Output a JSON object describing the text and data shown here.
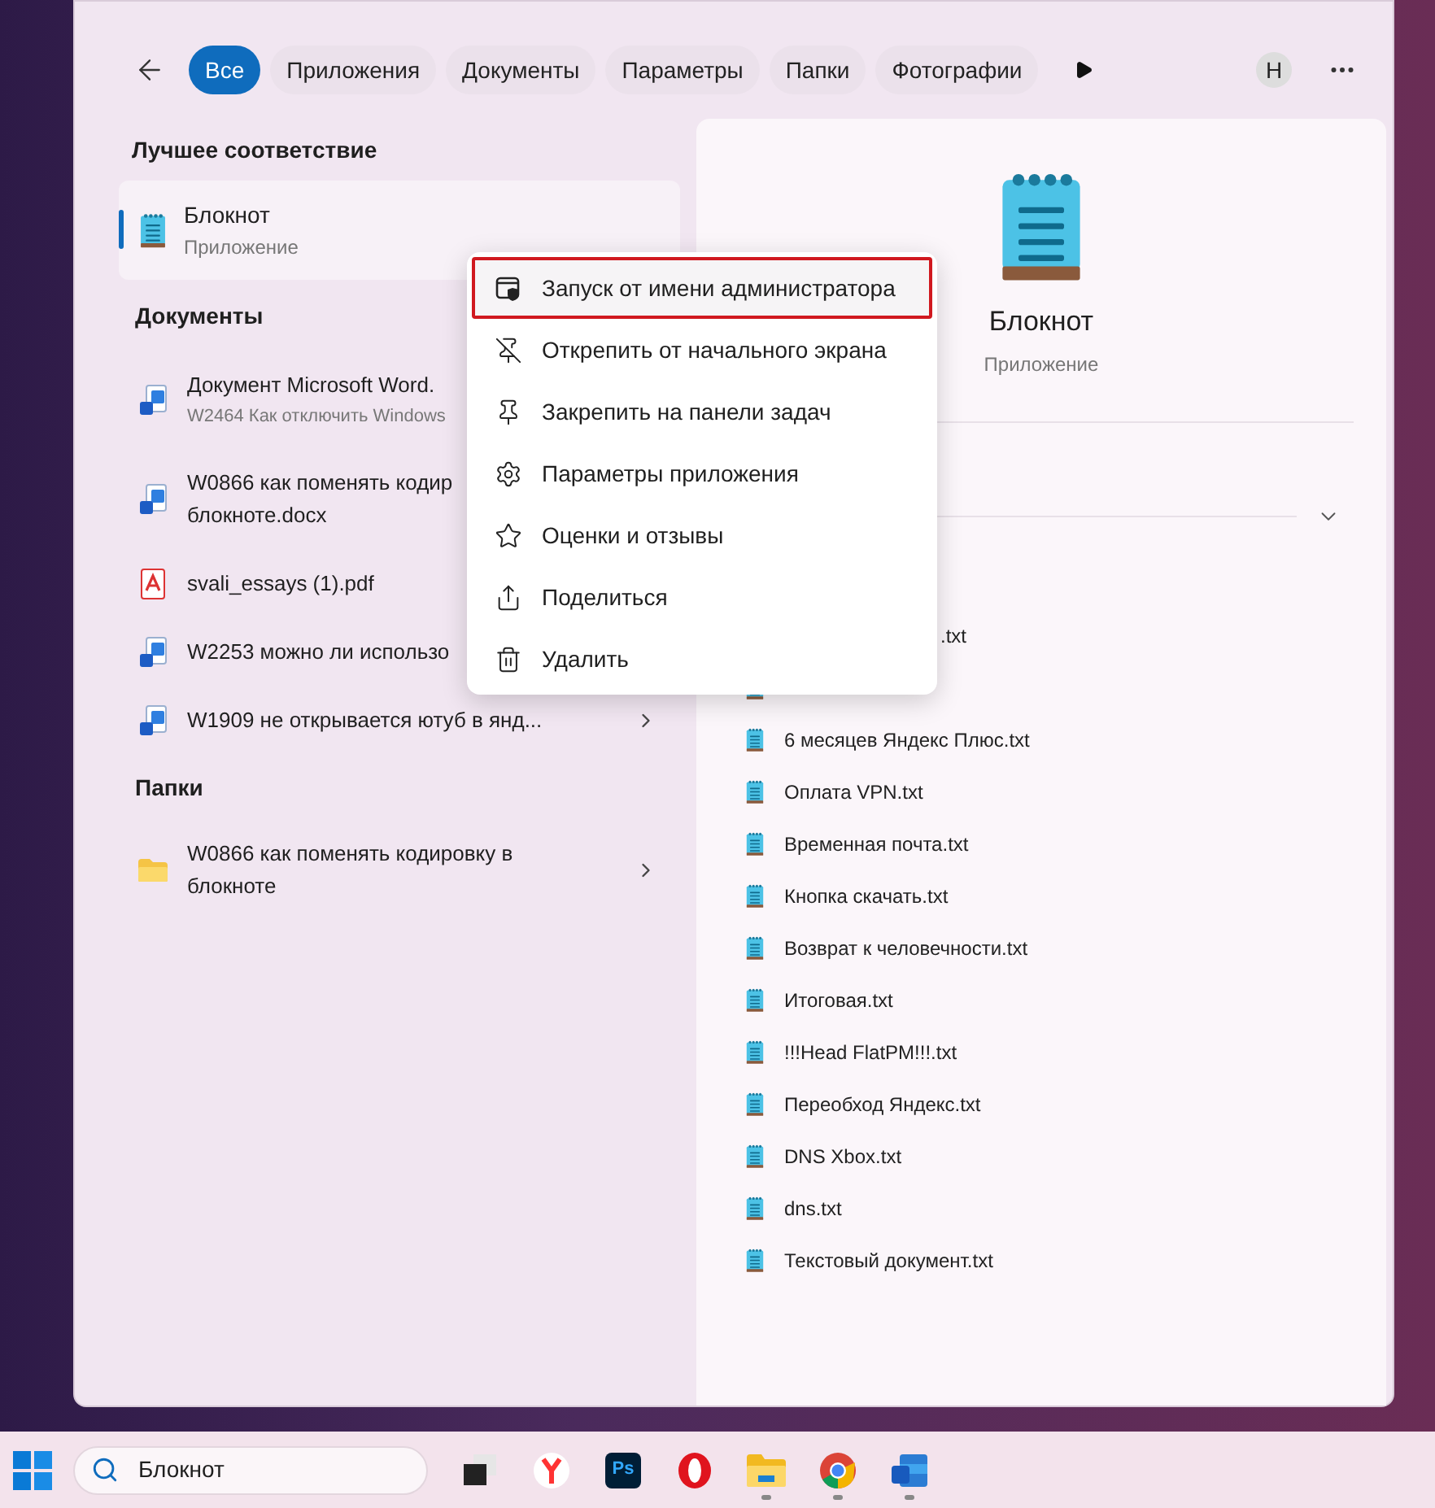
{
  "filters": [
    {
      "label": "Все",
      "selected": true
    },
    {
      "label": "Приложения",
      "selected": false
    },
    {
      "label": "Документы",
      "selected": false
    },
    {
      "label": "Параметры",
      "selected": false
    },
    {
      "label": "Папки",
      "selected": false
    },
    {
      "label": "Фотографии",
      "selected": false
    }
  ],
  "avatar": "Н",
  "best_match": {
    "heading": "Лучшее соответствие",
    "name": "Блокнот",
    "subtitle": "Приложение",
    "selected": true
  },
  "documents": {
    "heading": "Документы",
    "items": [
      {
        "kind": "word",
        "lines": [
          "Документ Microsoft Word."
        ],
        "subtitle": "W2464 Как отключить Windows"
      },
      {
        "kind": "word",
        "lines": [
          "W0866 как поменять кодир",
          "блокноте.docx"
        ]
      },
      {
        "kind": "pdf",
        "lines": [
          "svali_essays (1).pdf"
        ]
      },
      {
        "kind": "word",
        "lines": [
          "W2253 можно ли использо"
        ]
      },
      {
        "kind": "word",
        "lines": [
          "W1909 не открывается ютуб в янд..."
        ],
        "arrow": true
      }
    ]
  },
  "folders": {
    "heading": "Папки",
    "items": [
      {
        "kind": "folder",
        "lines": [
          "W0866 как поменять кодировку в",
          "блокноте"
        ],
        "arrow": true
      }
    ]
  },
  "details": {
    "name": "Блокнот",
    "type": "Приложение",
    "recent": [
      {
        "kind": "tail",
        "name": ".txt"
      },
      {
        "kind": "icon_only"
      },
      {
        "kind": "file",
        "name": "6 месяцев Яндекс Плюс.txt"
      },
      {
        "kind": "file",
        "name": "Оплата VPN.txt"
      },
      {
        "kind": "file",
        "name": "Временная почта.txt"
      },
      {
        "kind": "file",
        "name": "Кнопка скачать.txt"
      },
      {
        "kind": "file",
        "name": "Возврат к человечности.txt"
      },
      {
        "kind": "file",
        "name": "Итоговая.txt"
      },
      {
        "kind": "file",
        "name": "!!!Head FlatPM!!!.txt"
      },
      {
        "kind": "file",
        "name": "Переобход Яндекс.txt"
      },
      {
        "kind": "file",
        "name": "DNS Xbox.txt"
      },
      {
        "kind": "file",
        "name": "dns.txt"
      },
      {
        "kind": "file",
        "name": "Текстовый документ.txt"
      }
    ]
  },
  "context_menu": [
    {
      "label": "Запуск от имени администратора",
      "highlighted": true
    },
    {
      "label": "Открепить от начального экрана",
      "highlighted": false
    },
    {
      "label": "Закрепить на панели задач",
      "highlighted": false
    },
    {
      "label": "Параметры приложения",
      "highlighted": false
    },
    {
      "label": "Оценки и отзывы",
      "highlighted": false
    },
    {
      "label": "Поделиться",
      "highlighted": false
    },
    {
      "label": "Удалить",
      "highlighted": false
    }
  ],
  "taskbar": {
    "search": {
      "value": "Блокнот"
    },
    "apps": [
      {
        "kind": "taskview",
        "running": false
      },
      {
        "kind": "yandex",
        "running": false
      },
      {
        "kind": "photoshop",
        "label": "Ps",
        "running": false
      },
      {
        "kind": "opera",
        "running": false
      },
      {
        "kind": "explorer",
        "running": true
      },
      {
        "kind": "chrome",
        "running": true
      },
      {
        "kind": "word",
        "running": true
      }
    ]
  }
}
